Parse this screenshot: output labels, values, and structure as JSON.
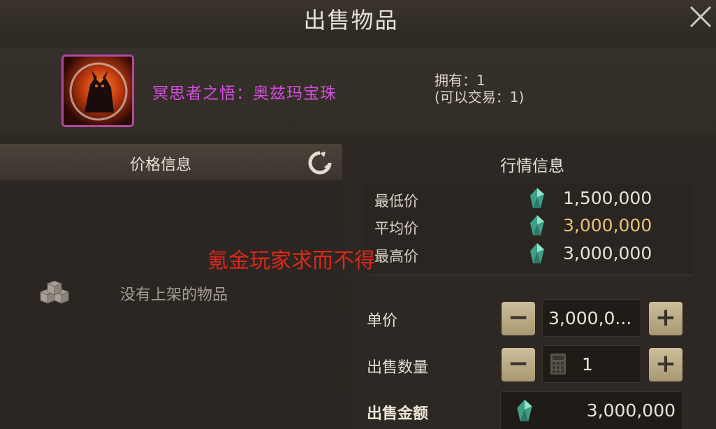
{
  "window": {
    "title": "出售物品",
    "close_icon": "close-icon"
  },
  "item": {
    "name": "冥思者之悟：奥兹玛宝珠",
    "name_color": "#d34fe0",
    "owned_label": "拥有：1",
    "tradable_label": "(可以交易：1)"
  },
  "price_panel": {
    "title": "价格信息",
    "empty_text": "没有上架的物品"
  },
  "overlay_text": "氪金玩家求而不得",
  "market": {
    "title": "行情信息",
    "rows": [
      {
        "label": "最低价",
        "value": "1,500,000"
      },
      {
        "label": "平均价",
        "value": "3,000,000"
      },
      {
        "label": "最高价",
        "value": "3,000,000"
      }
    ]
  },
  "sell_form": {
    "unit_price_label": "单价",
    "unit_price_value": "3,000,0...",
    "quantity_label": "出售数量",
    "quantity_value": "1",
    "total_label": "出售金额",
    "total_value": "3,000,000",
    "minus": "−",
    "plus": "+"
  },
  "colors": {
    "gold": "#e8c27a",
    "promo_red": "#e0261c",
    "accent_button": "#cdbf9a"
  }
}
